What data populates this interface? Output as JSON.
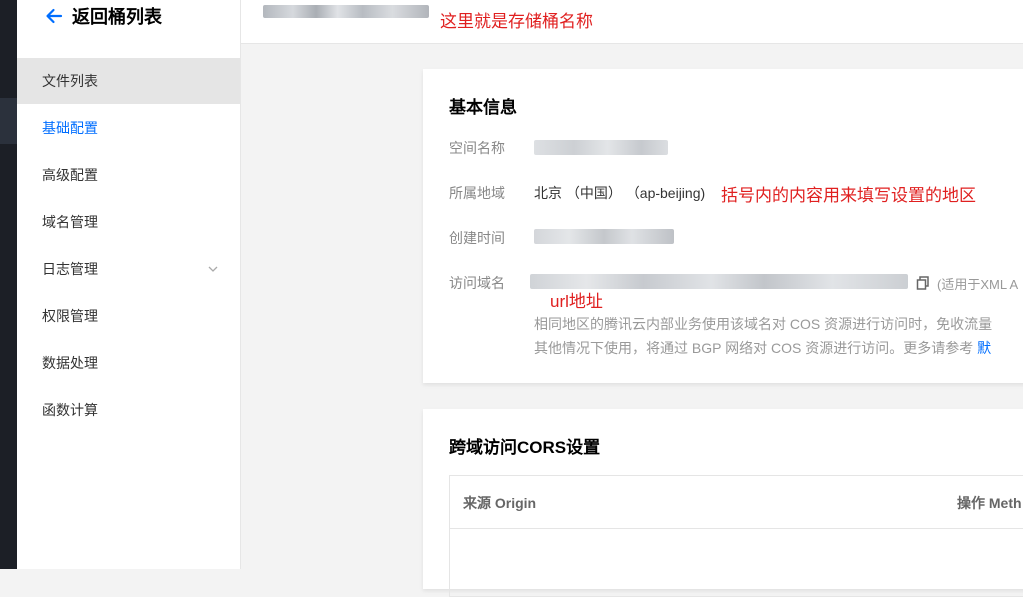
{
  "sidebar": {
    "back_label": "返回桶列表",
    "items": [
      {
        "label": "文件列表"
      },
      {
        "label": "基础配置"
      },
      {
        "label": "高级配置"
      },
      {
        "label": "域名管理"
      },
      {
        "label": "日志管理"
      },
      {
        "label": "权限管理"
      },
      {
        "label": "数据处理"
      },
      {
        "label": "函数计算"
      }
    ]
  },
  "header": {
    "annotation": "这里就是存储桶名称"
  },
  "basic_info": {
    "title": "基本信息",
    "space_name_label": "空间名称",
    "region_label": "所属地域",
    "region_value": "北京 （中国） （ap-beijing)",
    "region_annotation": "括号内的内容用来填写设置的地区",
    "created_label": "创建时间",
    "domain_label": "访问域名",
    "domain_note": "(适用于XML A",
    "url_annotation": "url地址",
    "hint_line1": "相同地区的腾讯云内部业务使用该域名对 COS 资源进行访问时，免收流量",
    "hint_line2": "其他情况下使用，将通过 BGP 网络对 COS 资源进行访问。更多请参考",
    "hint_link": "默"
  },
  "cors": {
    "title": "跨域访问CORS设置",
    "col_origin": "来源 Origin",
    "col_method": "操作 Meth"
  },
  "colors": {
    "accent": "#006eff",
    "annotation": "#e02020",
    "sidebar_hover": "#e5e5e5"
  }
}
